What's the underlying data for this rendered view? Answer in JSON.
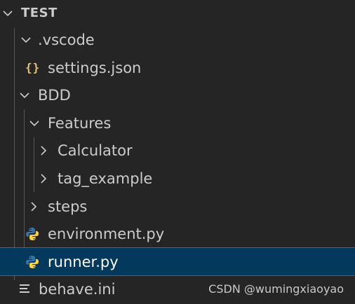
{
  "explorer": {
    "root": {
      "label": "TEST",
      "expanded": true,
      "icon": "chevron-down-icon"
    },
    "items": [
      {
        "label": ".vscode",
        "type": "folder",
        "expanded": true,
        "icon": "chevron-down-icon"
      },
      {
        "label": "settings.json",
        "type": "file",
        "icon": "json-icon",
        "icon_glyph": "{}"
      },
      {
        "label": "BDD",
        "type": "folder",
        "expanded": true,
        "icon": "chevron-down-icon"
      },
      {
        "label": "Features",
        "type": "folder",
        "expanded": true,
        "icon": "chevron-down-icon"
      },
      {
        "label": "Calculator",
        "type": "folder",
        "expanded": false,
        "icon": "chevron-right-icon"
      },
      {
        "label": "tag_example",
        "type": "folder",
        "expanded": false,
        "icon": "chevron-right-icon"
      },
      {
        "label": "steps",
        "type": "folder",
        "expanded": false,
        "icon": "chevron-right-icon"
      },
      {
        "label": "environment.py",
        "type": "file",
        "icon": "python-icon"
      },
      {
        "label": "runner.py",
        "type": "file",
        "icon": "python-icon",
        "selected": true
      },
      {
        "label": "behave.ini",
        "type": "file",
        "icon": "ini-file-icon"
      }
    ]
  },
  "watermark": "CSDN @wumingxiaoyao",
  "colors": {
    "background": "#252526",
    "selection": "#04395e",
    "selection_border": "#2f6aa3",
    "text": "#cccccc",
    "json_icon": "#e5c07b",
    "python_blue": "#3572A5",
    "python_yellow": "#FFD43B"
  }
}
